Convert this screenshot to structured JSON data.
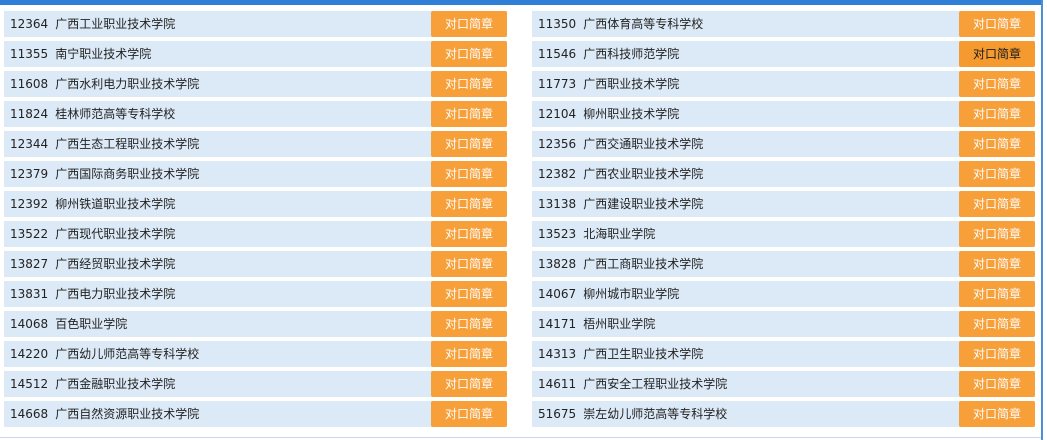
{
  "colors": {
    "accent_bar": "#2f7fd6",
    "row_background": "#dce9f6",
    "button_background": "#f7a03a",
    "button_text": "#ffffff",
    "button_hover_text": "#1a1a1a"
  },
  "button_label": "对口简章",
  "left_column": [
    {
      "code": "12364",
      "name": "广西工业职业技术学院"
    },
    {
      "code": "11355",
      "name": "南宁职业技术学院"
    },
    {
      "code": "11608",
      "name": "广西水利电力职业技术学院"
    },
    {
      "code": "11824",
      "name": "桂林师范高等专科学校"
    },
    {
      "code": "12344",
      "name": "广西生态工程职业技术学院"
    },
    {
      "code": "12379",
      "name": "广西国际商务职业技术学院"
    },
    {
      "code": "12392",
      "name": "柳州铁道职业技术学院"
    },
    {
      "code": "13522",
      "name": "广西现代职业技术学院"
    },
    {
      "code": "13827",
      "name": "广西经贸职业技术学院"
    },
    {
      "code": "13831",
      "name": "广西电力职业技术学院"
    },
    {
      "code": "14068",
      "name": "百色职业学院"
    },
    {
      "code": "14220",
      "name": "广西幼儿师范高等专科学校"
    },
    {
      "code": "14512",
      "name": "广西金融职业技术学院"
    },
    {
      "code": "14668",
      "name": "广西自然资源职业技术学院"
    }
  ],
  "right_column": [
    {
      "code": "11350",
      "name": "广西体育高等专科学校"
    },
    {
      "code": "11546",
      "name": "广西科技师范学院",
      "hover": true
    },
    {
      "code": "11773",
      "name": "广西职业技术学院"
    },
    {
      "code": "12104",
      "name": "柳州职业技术学院"
    },
    {
      "code": "12356",
      "name": "广西交通职业技术学院"
    },
    {
      "code": "12382",
      "name": "广西农业职业技术学院"
    },
    {
      "code": "13138",
      "name": "广西建设职业技术学院"
    },
    {
      "code": "13523",
      "name": "北海职业学院"
    },
    {
      "code": "13828",
      "name": "广西工商职业技术学院"
    },
    {
      "code": "14067",
      "name": "柳州城市职业学院"
    },
    {
      "code": "14171",
      "name": "梧州职业学院"
    },
    {
      "code": "14313",
      "name": "广西卫生职业技术学院"
    },
    {
      "code": "14611",
      "name": "广西安全工程职业技术学院"
    },
    {
      "code": "51675",
      "name": "崇左幼儿师范高等专科学校"
    }
  ]
}
